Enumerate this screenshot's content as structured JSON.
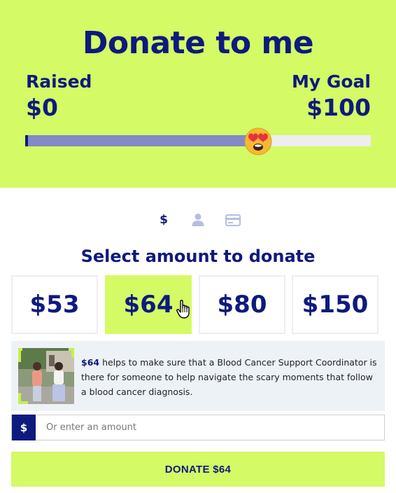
{
  "hero": {
    "title": "Donate to me",
    "raised_label": "Raised",
    "raised_value": "$0",
    "goal_label": "My Goal",
    "goal_value": "$100",
    "progress_fraction": 0.64,
    "progress_emoji": "heart-eyes-emoji",
    "background_color": "#d4fa66",
    "text_color": "#0e1a7e"
  },
  "steps": {
    "dollar_symbol": "$",
    "items": [
      "dollar-icon",
      "user-icon",
      "credit-card-icon"
    ]
  },
  "select": {
    "title": "Select amount to donate",
    "amounts": [
      "$53",
      "$64",
      "$80",
      "$150"
    ],
    "selected": "$64"
  },
  "info": {
    "amount": "$64",
    "text": " helps to make sure that a Blood Cancer Support Coordinator is there for someone to help navigate the scary moments that follow a blood cancer diagnosis."
  },
  "custom_amount": {
    "currency": "$",
    "placeholder": "Or enter an amount",
    "value": ""
  },
  "donate_button": {
    "label": "DONATE $64"
  },
  "colors": {
    "accent": "#d4fa66",
    "primary": "#0e1a7e",
    "progress_fill": "#8388c8",
    "info_bg": "#edf2f7"
  }
}
